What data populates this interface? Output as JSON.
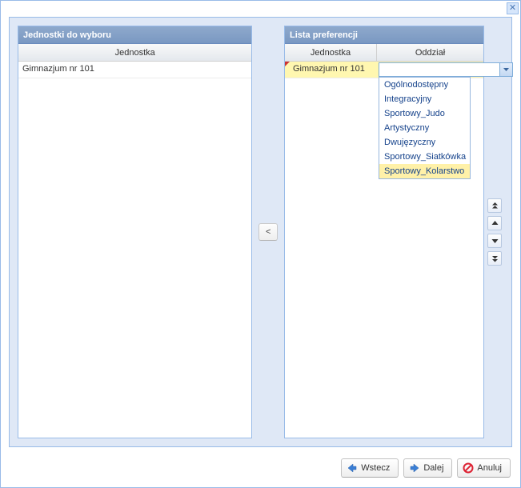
{
  "left_panel": {
    "title": "Jednostki do wyboru",
    "column": "Jednostka",
    "rows": [
      {
        "name": "Gimnazjum nr 101"
      }
    ]
  },
  "right_panel": {
    "title": "Lista preferencji",
    "col_unit": "Jednostka",
    "col_dept": "Oddział",
    "rows": [
      {
        "name": "Gimnazjum nr 101",
        "dept_value": ""
      }
    ],
    "dropdown_options": [
      "Ogólnodostępny",
      "Integracyjny",
      "Sportowy_Judo",
      "Artystyczny",
      "Dwujęzyczny",
      "Sportowy_Siatkówka",
      "Sportowy_Kolarstwo"
    ]
  },
  "move_button_label": "<",
  "footer": {
    "back": "Wstecz",
    "next": "Dalej",
    "cancel": "Anuluj"
  }
}
